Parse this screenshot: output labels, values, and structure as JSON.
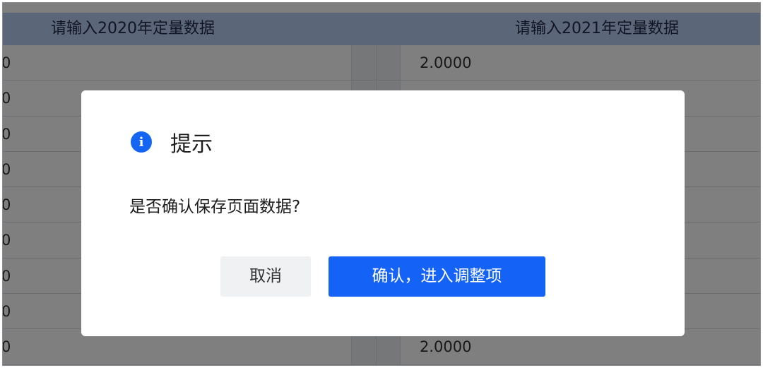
{
  "table": {
    "columns": [
      "请输入2020年定量数据",
      "请输入2021年定量数据"
    ],
    "rows": [
      {
        "col1": "0",
        "col2": "2.0000"
      },
      {
        "col1": "0",
        "col2": ""
      },
      {
        "col1": "0",
        "col2": ""
      },
      {
        "col1": "0",
        "col2": ""
      },
      {
        "col1": "0",
        "col2": ""
      },
      {
        "col1": "0",
        "col2": ""
      },
      {
        "col1": "0",
        "col2": ""
      },
      {
        "col1": "0",
        "col2": ""
      },
      {
        "col1": "0",
        "col2": "2.0000"
      }
    ]
  },
  "dialog": {
    "icon": "info-icon",
    "icon_glyph": "i",
    "title": "提示",
    "message": "是否确认保存页面数据?",
    "cancel_label": "取消",
    "confirm_label": "确认，进入调整项",
    "accent_color": "#1462f6"
  }
}
